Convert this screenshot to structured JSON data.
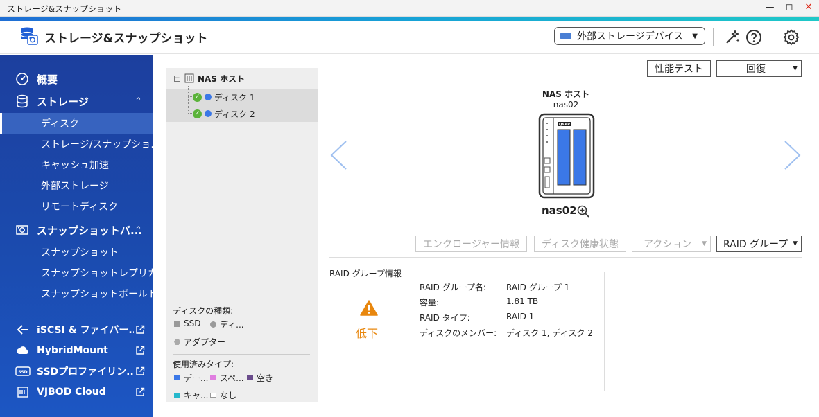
{
  "window": {
    "title": "ストレージ&スナップショット",
    "controls": [
      "minimize",
      "maximize",
      "close"
    ]
  },
  "header": {
    "title": "ストレージ&スナップショット",
    "external_device_select": "外部ストレージデバイス",
    "icons": [
      "magic-wand-icon",
      "help-icon",
      "settings-icon"
    ]
  },
  "sidebar": {
    "overview": "概要",
    "storage": "ストレージ",
    "storage_items": [
      "ディスク",
      "ストレージ/スナップショ...",
      "キャッシュ加速",
      "外部ストレージ",
      "リモートディスク"
    ],
    "snapshot": "スナップショットバ...",
    "snapshot_items": [
      "スナップショット",
      "スナップショットレプリカ",
      "スナップショットボールト"
    ],
    "links": [
      "iSCSI & ファイバー...",
      "HybridMount",
      "SSDプロファイリン...",
      "VJBOD Cloud"
    ]
  },
  "tree": {
    "root": "NAS ホスト",
    "disks": [
      "ディスク 1",
      "ディスク 2"
    ],
    "disk_type_title": "ディスクの種類:",
    "disk_types": [
      "SSD",
      "ディ...",
      "アダプター"
    ],
    "used_type_title": "使用済みタイプ:",
    "used_types": [
      {
        "label": "デー...",
        "color": "#3b78e7"
      },
      {
        "label": "スペ...",
        "color": "#e07ee0"
      },
      {
        "label": "空き",
        "color": "#6a4c8c"
      },
      {
        "label": "キャ...",
        "color": "#26b8cc"
      },
      {
        "label": "なし",
        "color": "#ffffff"
      }
    ]
  },
  "main": {
    "perf_test": "性能テスト",
    "recover": "回復",
    "host_label": "NAS ホスト",
    "host_name": "nas02",
    "device_name": "nas02",
    "brand": "QNAP",
    "enclosure_info": "エンクロージャー情報",
    "disk_health": "ディスク健康状態",
    "action": "アクション",
    "raid_group_select": "RAID グループ",
    "raid_info_title": "RAID グループ情報",
    "status": "低下",
    "status_color": "#e8870e",
    "details": [
      {
        "key": "RAID グループ名:",
        "value": "RAID グループ 1"
      },
      {
        "key": "容量:",
        "value": "1.81 TB"
      },
      {
        "key": "RAID タイプ:",
        "value": "RAID 1"
      },
      {
        "key": "ディスクのメンバー:",
        "value": "ディスク 1, ディスク 2"
      }
    ]
  }
}
